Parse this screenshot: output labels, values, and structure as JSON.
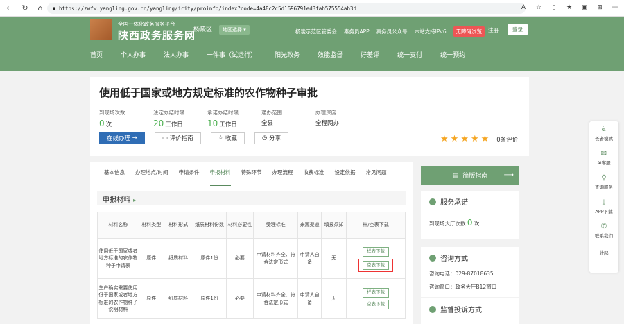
{
  "browser": {
    "url": "https://zwfw.yangling.gov.cn/yangling/icity/proinfo/index?code=4a48c2c5d1696791ed3fab575554ab3d"
  },
  "header": {
    "site_sub": "全国一体化政务服务平台",
    "site_title": "陕西政务服务网",
    "district": "杨陵区",
    "region_select": "地区选择",
    "top_links": [
      "杨凌示范区管委会",
      "秦务员APP",
      "秦务员公众号",
      "本站支持IPv6"
    ],
    "no_barrier": "无障碍浏览",
    "login": "注册",
    "register": "登录",
    "nav": [
      "首页",
      "个人办事",
      "法人办事",
      "一件事（试运行）",
      "阳光政务",
      "效能监督",
      "好差评",
      "统一支付",
      "统一预约"
    ]
  },
  "service": {
    "title": "使用低于国家或地方规定标准的农作物种子审批",
    "stats": [
      {
        "label": "到现场次数",
        "num": "0",
        "unit": "次"
      },
      {
        "label": "法定办结时限",
        "num": "20",
        "unit": "工作日"
      },
      {
        "label": "承诺办结时限",
        "num": "10",
        "unit": "工作日"
      },
      {
        "label": "通办范围",
        "num": "",
        "unit": "全县"
      },
      {
        "label": "办理深度",
        "num": "",
        "unit": "全程网办"
      }
    ],
    "actions": {
      "online": "在线办理",
      "guide": "评价指南",
      "collect": "收藏",
      "share": "分享"
    },
    "rating_text": "0条评价"
  },
  "tabs": [
    "基本信息",
    "办理地点/时间",
    "申请条件",
    "申报材料",
    "特殊环节",
    "办理流程",
    "收费标准",
    "设定依据",
    "常见问题"
  ],
  "materials": {
    "section_title": "申报材料",
    "headers": [
      "材料名称",
      "材料类型",
      "材料形式",
      "纸质材料份数",
      "材料必要性",
      "受理标准",
      "来源渠道",
      "填报须知",
      "样/空表下载"
    ],
    "rows": [
      [
        "使用低于国家或者地方标准的农作物种子申请表",
        "原件",
        "纸质材料",
        "原件1份",
        "必要",
        "申请材料齐全、符合法定形式",
        "申请人自备",
        "无"
      ],
      [
        "生产确实需要使用低于国家或者地方标准的农作物种子说明材料",
        "原件",
        "纸质材料",
        "原件1份",
        "必要",
        "申请材料齐全、符合法定形式",
        "申请人自备",
        "无"
      ]
    ],
    "sample_dl": "样表下载",
    "blank_dl": "空表下载"
  },
  "sidebar": {
    "guide": "简版指南",
    "promise_title": "服务承诺",
    "promise_label": "到现场大厅次数",
    "promise_num": "0",
    "promise_unit": "次",
    "consult_title": "咨询方式",
    "consult_phone": "咨询电话：029-87018635",
    "consult_window": "咨询窗口：政务大厅B12窗口",
    "complaint_title": "监督投诉方式"
  },
  "floatbar": [
    "长者模式",
    "AI客服",
    "查询服务",
    "APP下载",
    "联系我们",
    "收起"
  ],
  "colors": {
    "brand": "#6fa073",
    "primary": "#2f6db5",
    "star": "#f5a623",
    "highlight": "#e33333"
  }
}
